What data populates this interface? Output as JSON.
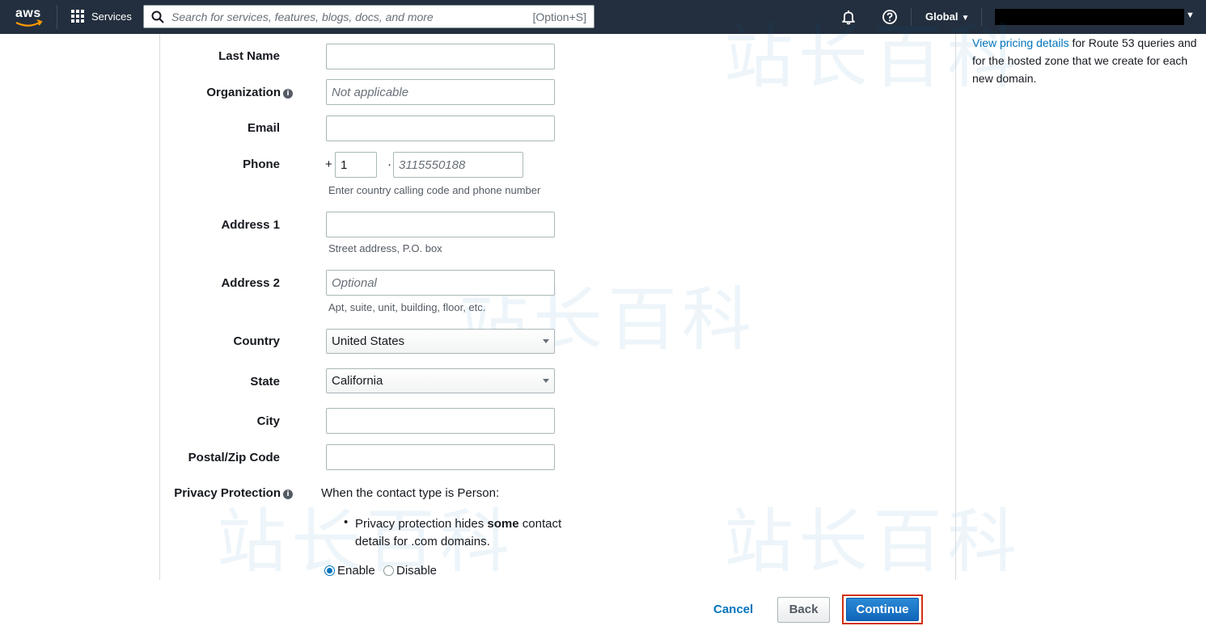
{
  "topnav": {
    "logo": "aws",
    "services_label": "Services",
    "search_placeholder": "Search for services, features, blogs, docs, and more",
    "search_shortcut": "[Option+S]",
    "region": "Global"
  },
  "help_panel": {
    "link": "View pricing details",
    "text": " for Route 53 queries and for the hosted zone that we create for each new domain."
  },
  "form": {
    "last_name_label": "Last Name",
    "organization_label": "Organization",
    "organization_placeholder": "Not applicable",
    "email_label": "Email",
    "phone_label": "Phone",
    "phone_plus": "+",
    "phone_country_code": "1",
    "phone_dot": "·",
    "phone_placeholder": "3115550188",
    "phone_hint": "Enter country calling code and phone number",
    "address1_label": "Address 1",
    "address1_hint": "Street address, P.O. box",
    "address2_label": "Address 2",
    "address2_placeholder": "Optional",
    "address2_hint": "Apt, suite, unit, building, floor, etc.",
    "country_label": "Country",
    "country_value": "United States",
    "state_label": "State",
    "state_value": "California",
    "city_label": "City",
    "postal_label": "Postal/Zip Code",
    "privacy_label": "Privacy Protection",
    "privacy_intro": "When the contact type is Person:",
    "privacy_bullet_pre": "Privacy protection hides ",
    "privacy_bullet_bold": "some",
    "privacy_bullet_post": " contact",
    "privacy_bullet_line2": "details for .com domains.",
    "enable_label": "Enable",
    "disable_label": "Disable",
    "privacy_selected": "Enable"
  },
  "footer": {
    "cancel": "Cancel",
    "back": "Back",
    "continue": "Continue"
  }
}
